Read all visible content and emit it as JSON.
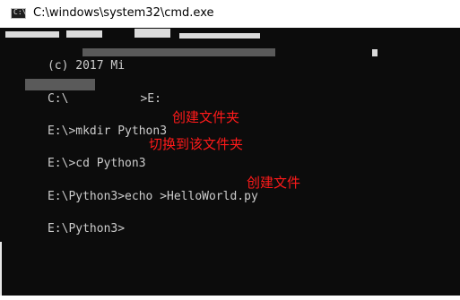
{
  "window": {
    "title": "C:\\windows\\system32\\cmd.exe",
    "icon": "cmd-prompt-icon",
    "icon_glyph": "C:\\"
  },
  "console": {
    "lines": [
      {
        "text": "(c) 2017 Mi",
        "redacted": true
      },
      {
        "text": "C:\\",
        "suffix": ">E:",
        "redacted": true
      },
      {
        "text": "E:\\>mkdir Python3"
      },
      {
        "text": "E:\\>cd Python3"
      },
      {
        "text": "E:\\Python3>echo >HelloWorld.py"
      },
      {
        "text": "E:\\Python3>"
      }
    ],
    "annotations": [
      "创建文件夹",
      "切换到该文件夹",
      "创建文件"
    ]
  },
  "colors": {
    "console_bg": "#0c0c0c",
    "console_text": "#cccccc",
    "annotation": "#ff1a1a",
    "titlebar_bg": "#ffffff"
  }
}
